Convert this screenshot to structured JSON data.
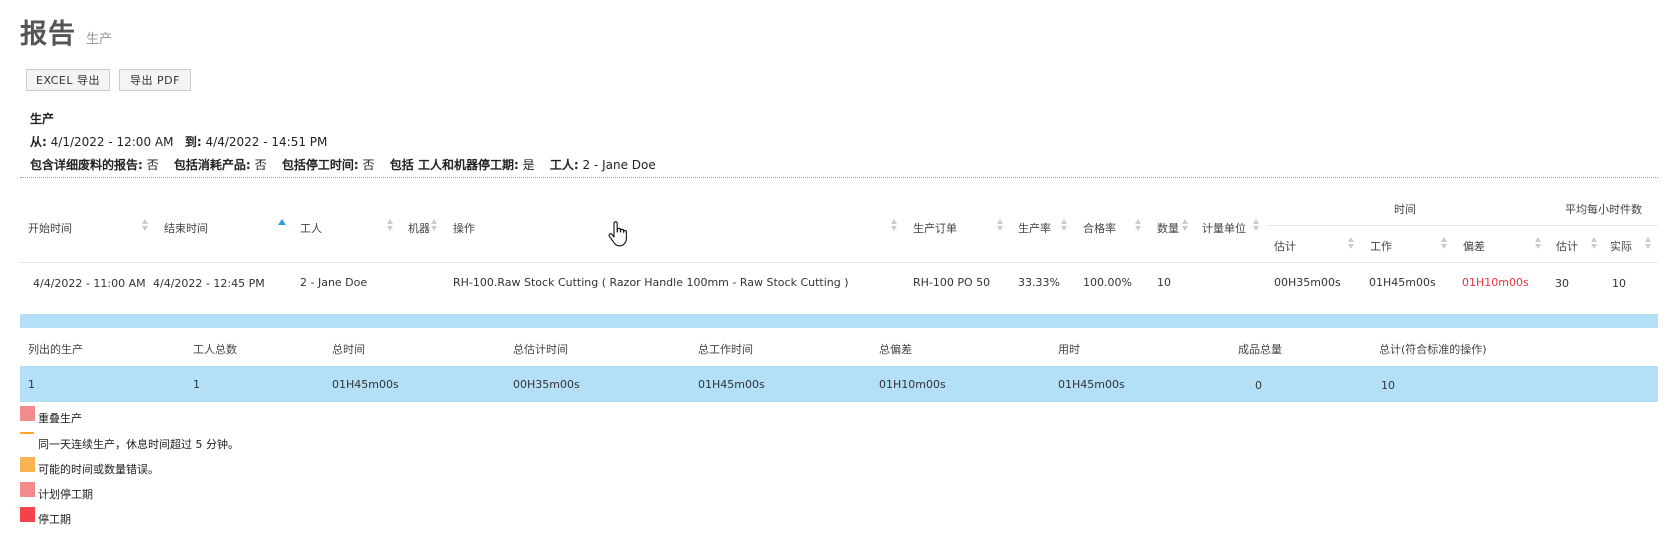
{
  "header": {
    "title": "报告",
    "subtitle": "生产"
  },
  "toolbar": {
    "excel_label": "EXCEL 导出",
    "pdf_label": "导出 PDF"
  },
  "params": {
    "title": "生产",
    "from_label": "从:",
    "from_value": "4/1/2022 - 12:00 AM",
    "to_label": "到:",
    "to_value": "4/4/2022 - 14:51 PM",
    "scrap_label": "包含详细废料的报告:",
    "scrap_value": "否",
    "consumed_label": "包括消耗产品:",
    "consumed_value": "否",
    "downtime_label": "包括停工时间:",
    "downtime_value": "否",
    "worker_machine_label": "包括 工人和机器停工期:",
    "worker_machine_value": "是",
    "worker_label": "工人:",
    "worker_value": "2 - Jane Doe"
  },
  "table": {
    "group_time": "时间",
    "group_avg": "平均每小时件数",
    "columns": {
      "start": "开始时间",
      "end": "结束时间",
      "worker": "工人",
      "machine": "机器",
      "operation": "操作",
      "order": "生产订单",
      "rate": "生产率",
      "pass_rate": "合格率",
      "qty": "数量",
      "unit": "计量单位",
      "time_est": "估计",
      "time_work": "工作",
      "time_dev": "偏差",
      "avg_est": "估计",
      "avg_actual": "实际"
    },
    "rows": [
      {
        "start": "4/4/2022 - 11:00 AM",
        "end": "4/4/2022 - 12:45 PM",
        "worker": "2 - Jane Doe",
        "operation": "RH-100.Raw Stock Cutting ( Razor Handle 100mm - Raw Stock Cutting )",
        "order": "RH-100 PO 50",
        "rate": "33.33%",
        "pass_rate": "100.00%",
        "qty": "10",
        "time_est": "00H35m00s",
        "time_work": "01H45m00s",
        "time_dev": "01H10m00s",
        "avg_est": "30",
        "avg_actual": "10"
      }
    ],
    "dev_color": "#e8323c"
  },
  "summary": {
    "headers": {
      "listed": "列出的生产",
      "workers": "工人总数",
      "total_time": "总时间",
      "total_est": "总估计时间",
      "total_work": "总工作时间",
      "total_dev": "总偏差",
      "used": "用时",
      "products": "成品总量",
      "total_std": "总计(符合标准的操作)"
    },
    "values": {
      "listed": "1",
      "workers": "1",
      "total_time": "01H45m00s",
      "total_est": "00H35m00s",
      "total_work": "01H45m00s",
      "total_dev": "01H10m00s",
      "used": "01H45m00s",
      "products": "0",
      "total_std": "10"
    },
    "row_color": "#b3e0f7"
  },
  "legend": {
    "overlap": {
      "label": "重叠生产",
      "color": "#f28b8b"
    },
    "break": {
      "label": "同一天连续生产，休息时间超过 5 分钟。",
      "color": "#f7a531"
    },
    "error": {
      "label": "可能的时间或数量错误。",
      "color": "#f7b552"
    },
    "planned": {
      "label": "计划停工期",
      "color": "#f28b8b"
    },
    "downtime": {
      "label": "停工期",
      "color": "#f2424a"
    }
  }
}
